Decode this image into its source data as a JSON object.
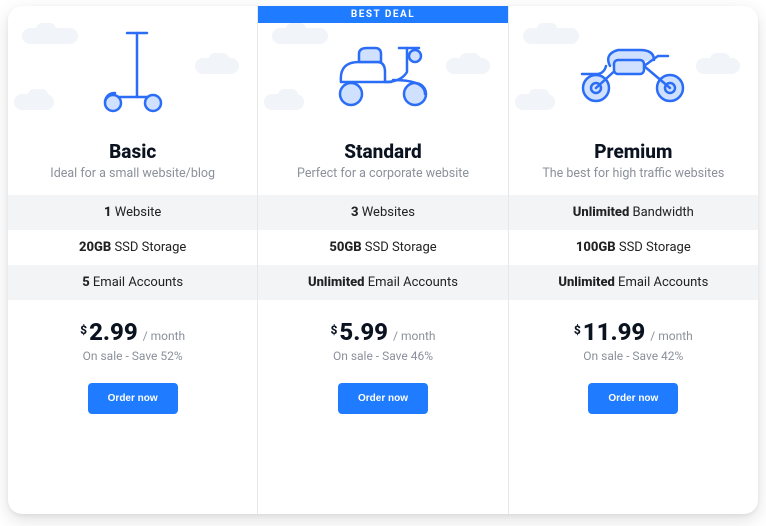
{
  "badge_label": "BEST DEAL",
  "currency_symbol": "$",
  "period_label": "/ month",
  "order_label": "Order now",
  "plans": [
    {
      "name": "Basic",
      "tagline": "Ideal for a small website/blog",
      "features": [
        {
          "bold": "1",
          "rest": " Website"
        },
        {
          "bold": "20GB",
          "rest": " SSD Storage"
        },
        {
          "bold": "5",
          "rest": " Email Accounts"
        }
      ],
      "price": "2.99",
      "sale_text": "On sale - Save 52%",
      "featured": false,
      "icon": "scooter"
    },
    {
      "name": "Standard",
      "tagline": "Perfect for a corporate website",
      "features": [
        {
          "bold": "3",
          "rest": " Websites"
        },
        {
          "bold": "50GB",
          "rest": " SSD Storage"
        },
        {
          "bold": "Unlimited",
          "rest": " Email Accounts"
        }
      ],
      "price": "5.99",
      "sale_text": "On sale - Save 46%",
      "featured": true,
      "icon": "moped"
    },
    {
      "name": "Premium",
      "tagline": "The best for high traffic websites",
      "features": [
        {
          "bold": "Unlimited",
          "rest": " Bandwidth"
        },
        {
          "bold": "100GB",
          "rest": " SSD Storage"
        },
        {
          "bold": "Unlimited",
          "rest": " Email Accounts"
        }
      ],
      "price": "11.99",
      "sale_text": "On sale - Save 42%",
      "featured": false,
      "icon": "motorcycle"
    }
  ]
}
